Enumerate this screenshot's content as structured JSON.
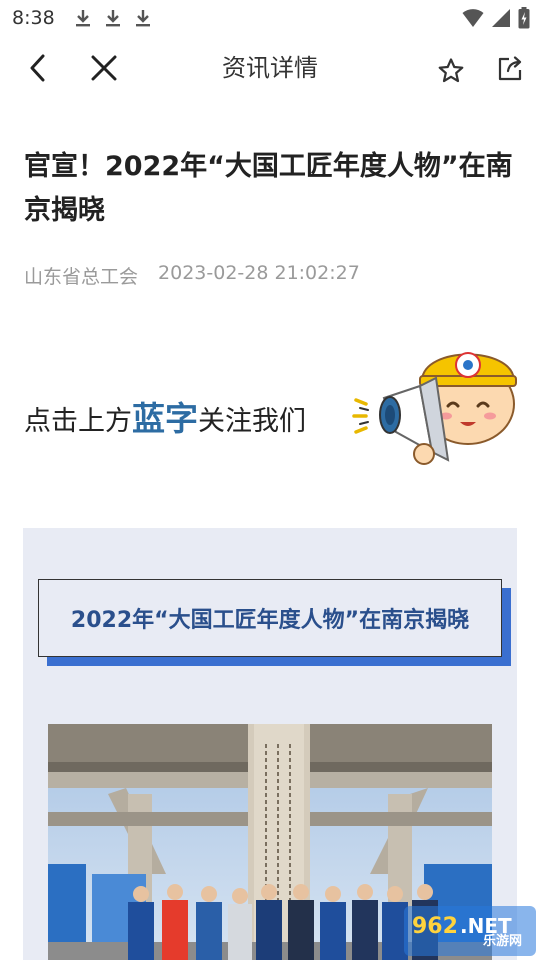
{
  "status_bar": {
    "time": "8:38",
    "download_icons": [
      "download-icon",
      "download-icon",
      "download-icon"
    ],
    "right_icons": [
      "wifi-icon",
      "signal-icon",
      "battery-charging-icon"
    ]
  },
  "nav": {
    "title": "资讯详情",
    "back_icon": "chevron-left-icon",
    "close_icon": "close-icon",
    "favorite_icon": "star-icon",
    "share_icon": "share-icon"
  },
  "article": {
    "title": "官宣！2022年“大国工匠年度人物”在南京揭晓",
    "source": "山东省总工会",
    "datetime": "2023-02-28 21:02:27"
  },
  "follow_banner": {
    "prefix": "点击上方",
    "highlight": "蓝字",
    "suffix": "关注我们"
  },
  "card": {
    "title": "2022年“大国工匠年度人物”在南京揭晓"
  },
  "watermark": {
    "logo": "962.NET",
    "text": "乐游网"
  },
  "colors": {
    "accent_blue": "#2d6ca3",
    "card_bg": "#e8ebf4",
    "card_title": "#2a4f8c",
    "card_shadow": "#3a6fd0",
    "meta_gray": "#9a9a9a"
  }
}
